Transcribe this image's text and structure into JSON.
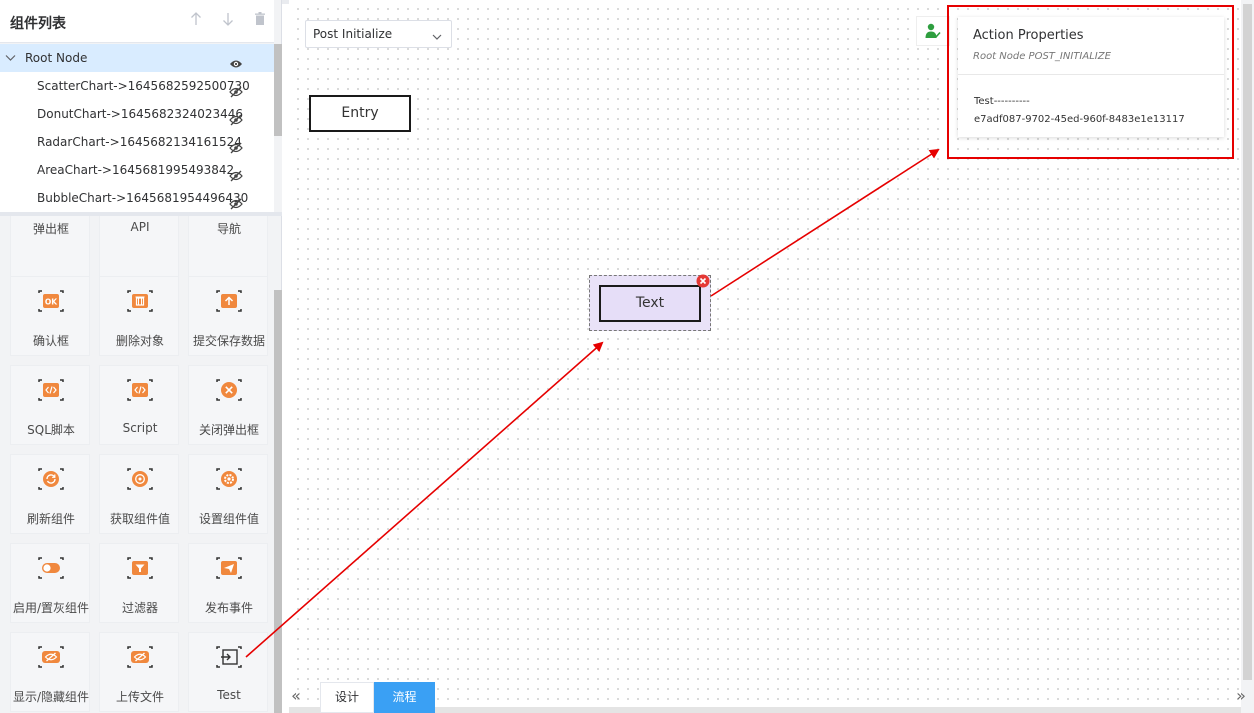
{
  "component_list": {
    "title": "组件列表",
    "header_icons": [
      "arrow-up-icon",
      "arrow-down-icon",
      "trash-icon"
    ]
  },
  "tree": {
    "root": {
      "label": "Root Node",
      "expanded": true,
      "visible": true
    },
    "children": [
      {
        "label": "ScatterChart->1645682592500730",
        "visible": false
      },
      {
        "label": "DonutChart->1645682324023446",
        "visible": false
      },
      {
        "label": "RadarChart->1645682134161524",
        "visible": false
      },
      {
        "label": "AreaChart->1645681995493842",
        "visible": false
      },
      {
        "label": "BubbleChart->1645681954496430",
        "visible": false
      }
    ]
  },
  "palette": [
    {
      "label": "弹出框",
      "icon": "popup-icon",
      "partial": true
    },
    {
      "label": "API",
      "icon": "api-icon",
      "partial": true
    },
    {
      "label": "导航",
      "icon": "navigation-icon",
      "partial": true
    },
    {
      "label": "确认框",
      "icon": "ok-icon"
    },
    {
      "label": "删除对象",
      "icon": "delete-object-icon"
    },
    {
      "label": "提交保存数据",
      "icon": "upload-icon"
    },
    {
      "label": "SQL脚本",
      "icon": "code-icon"
    },
    {
      "label": "Script",
      "icon": "code-icon"
    },
    {
      "label": "关闭弹出框",
      "icon": "close-circle-icon"
    },
    {
      "label": "刷新组件",
      "icon": "refresh-icon"
    },
    {
      "label": "获取组件值",
      "icon": "target-icon"
    },
    {
      "label": "设置组件值",
      "icon": "gear-icon"
    },
    {
      "label": "启用/置灰组件",
      "icon": "toggle-icon"
    },
    {
      "label": "过滤器",
      "icon": "filter-icon"
    },
    {
      "label": "发布事件",
      "icon": "send-icon"
    },
    {
      "label": "显示/隐藏组件",
      "icon": "eye-off-icon"
    },
    {
      "label": "上传文件",
      "icon": "eye-off-icon"
    },
    {
      "label": "Test",
      "icon": "login-icon"
    }
  ],
  "canvas": {
    "phase_select": {
      "value": "Post Initialize"
    },
    "entry_node": "Entry",
    "text_node": "Text"
  },
  "action_properties": {
    "title": "Action Properties",
    "subtitle": "Root Node POST_INITIALIZE",
    "line1": "Test----------",
    "line2": "e7adf087-9702-45ed-960f-8483e1e13117"
  },
  "bottom_tabs": {
    "design": "设计",
    "flow": "流程",
    "active": "flow"
  },
  "colors": {
    "accent": "#3aa0f4",
    "icon_orange": "#f0883e",
    "highlight_red": "#e60000",
    "tree_selected": "#d9ecff",
    "node_fill": "#e6def8"
  }
}
